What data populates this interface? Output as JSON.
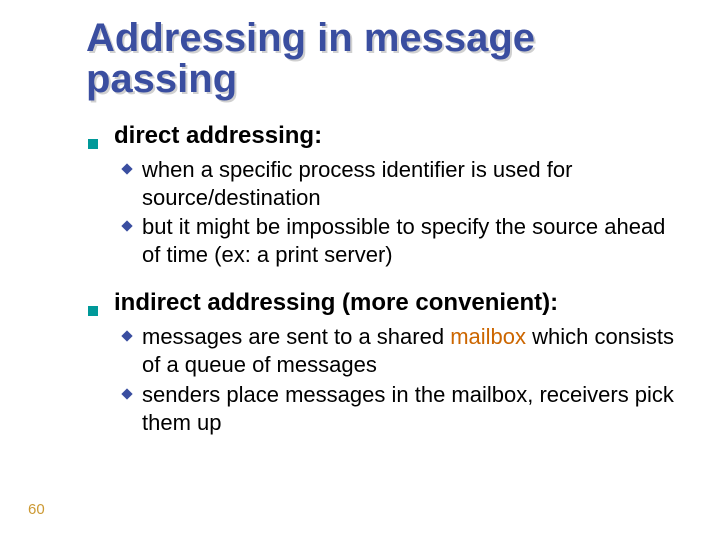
{
  "title": "Addressing in message passing",
  "sections": [
    {
      "heading": "direct addressing:",
      "items": [
        {
          "pre": "when",
          "rest": " a specific process identifier is used for source/destination"
        },
        {
          "pre": "but",
          "rest": " it might be impossible to specify the source ahead of time (ex: a print server)"
        }
      ]
    },
    {
      "heading": "indirect addressing (more convenient):",
      "items": [
        {
          "pre": "messages",
          "rest_before": " are sent to a shared ",
          "highlight": "mailbox",
          "rest_after": " which consists of a queue of messages"
        },
        {
          "pre": "senders",
          "rest": " place messages in the mailbox, receivers pick them up"
        }
      ]
    }
  ],
  "page_number": "60",
  "colors": {
    "title": "#3a4ea0",
    "square_bullet": "#009999",
    "diamond_bullet": "#3a4ea0",
    "highlight": "#cc6600",
    "pagenum": "#cc9933"
  }
}
